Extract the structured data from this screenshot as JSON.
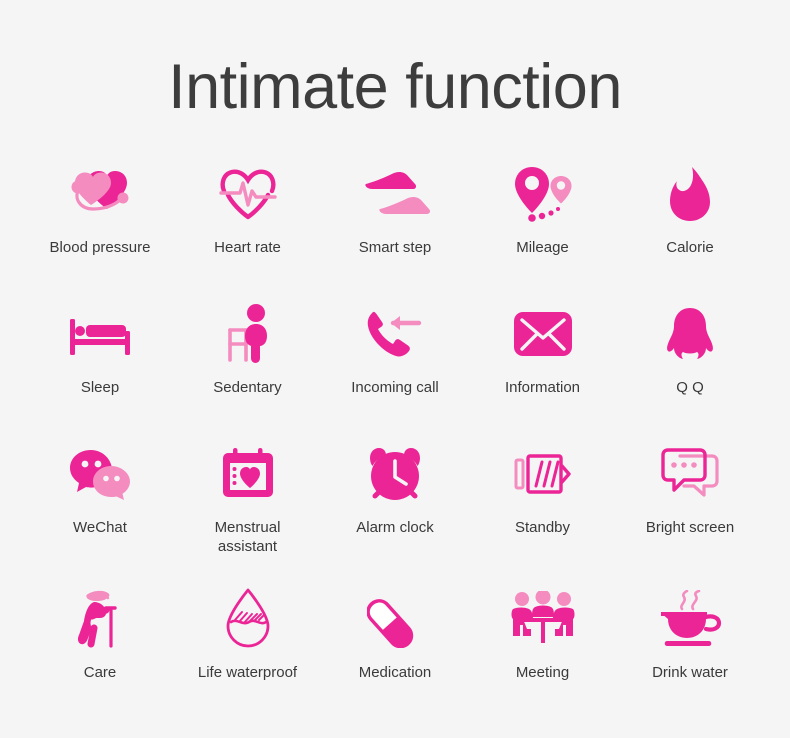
{
  "header": {
    "title": "Intimate function"
  },
  "colors": {
    "background": "#f5f5f5",
    "title_text": "#3d3d3d",
    "label_text": "#3a3a3a",
    "accent_dark_pink": "#ec2596",
    "accent_light_pink": "#f48cc0"
  },
  "grid": {
    "rows": [
      {
        "items": [
          {
            "label": "Blood pressure",
            "icon": "blood-pressure-icon"
          },
          {
            "label": "Heart rate",
            "icon": "heart-rate-icon"
          },
          {
            "label": "Smart step",
            "icon": "smart-step-icon"
          },
          {
            "label": "Mileage",
            "icon": "mileage-icon"
          },
          {
            "label": "Calorie",
            "icon": "calorie-icon"
          }
        ]
      },
      {
        "items": [
          {
            "label": "Sleep",
            "icon": "sleep-icon"
          },
          {
            "label": "Sedentary",
            "icon": "sedentary-icon"
          },
          {
            "label": "Incoming call",
            "icon": "incoming-call-icon"
          },
          {
            "label": "Information",
            "icon": "information-icon"
          },
          {
            "label": "Q Q",
            "icon": "qq-icon"
          }
        ]
      },
      {
        "items": [
          {
            "label": "WeChat",
            "icon": "wechat-icon"
          },
          {
            "label": "Menstrual\nassistant",
            "icon": "menstrual-assistant-icon"
          },
          {
            "label": "Alarm clock",
            "icon": "alarm-clock-icon"
          },
          {
            "label": "Standby",
            "icon": "standby-icon"
          },
          {
            "label": "Bright screen",
            "icon": "bright-screen-icon"
          }
        ]
      },
      {
        "items": [
          {
            "label": "Care",
            "icon": "care-icon"
          },
          {
            "label": "Life waterproof",
            "icon": "life-waterproof-icon"
          },
          {
            "label": "Medication",
            "icon": "medication-icon"
          },
          {
            "label": "Meeting",
            "icon": "meeting-icon"
          },
          {
            "label": "Drink water",
            "icon": "drink-water-icon"
          }
        ]
      }
    ]
  }
}
